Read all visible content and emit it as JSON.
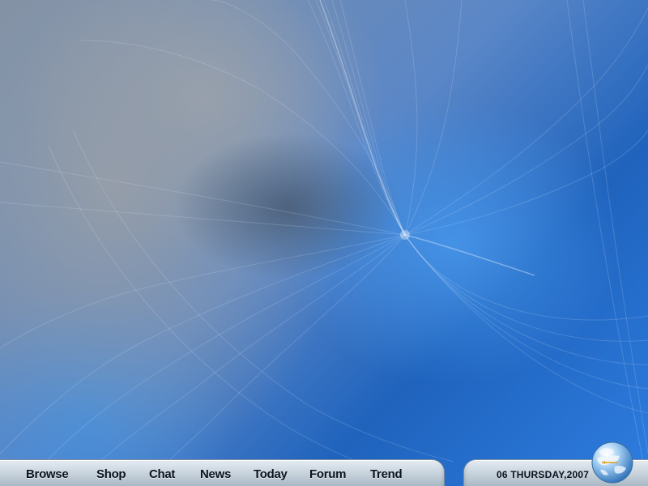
{
  "taskbar": {
    "nav_items": [
      "Browse",
      "Shop",
      "Chat",
      "News",
      "Today",
      "Forum",
      "Trend"
    ]
  },
  "clock": {
    "date_text": "06 THURSDAY,2007"
  },
  "icons": {
    "globe": "globe-icon"
  }
}
